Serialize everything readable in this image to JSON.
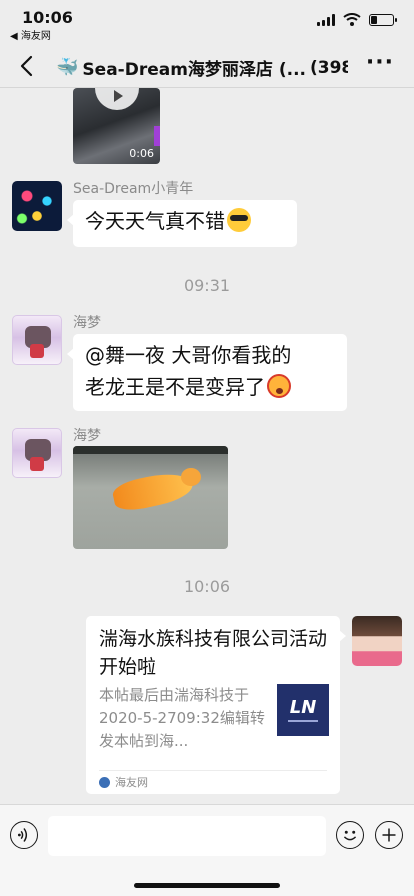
{
  "status_bar": {
    "time": "10:06",
    "back_app": "◀ 海友网"
  },
  "nav": {
    "title": "Sea-Dream海梦丽泽店 (...",
    "count": "(398)"
  },
  "messages": {
    "video_duration": "0:06",
    "m1": {
      "sender": "Sea-Dream小青年",
      "text": "今天天气真不错"
    },
    "time1": "09:31",
    "m2": {
      "sender": "海梦",
      "text_line1": "@舞一夜 大哥你看我的",
      "text_line2": "老龙王是不是变异了"
    },
    "m3": {
      "sender": "海梦"
    },
    "time2": "10:06",
    "card": {
      "title": "湍海水族科技有限公司活动开始啦",
      "desc": "本帖最后由湍海科技于2020-5-2709:32编辑转发本帖到海...",
      "source": "海友网"
    }
  },
  "colors": {
    "chat_bg": "#ededed",
    "bubble": "#ffffff",
    "meta_text": "#8a8a8a"
  },
  "icons": [
    "back-icon",
    "whale-icon",
    "mute-icon",
    "more-icon",
    "voice-icon",
    "emoji-icon",
    "plus-icon"
  ]
}
